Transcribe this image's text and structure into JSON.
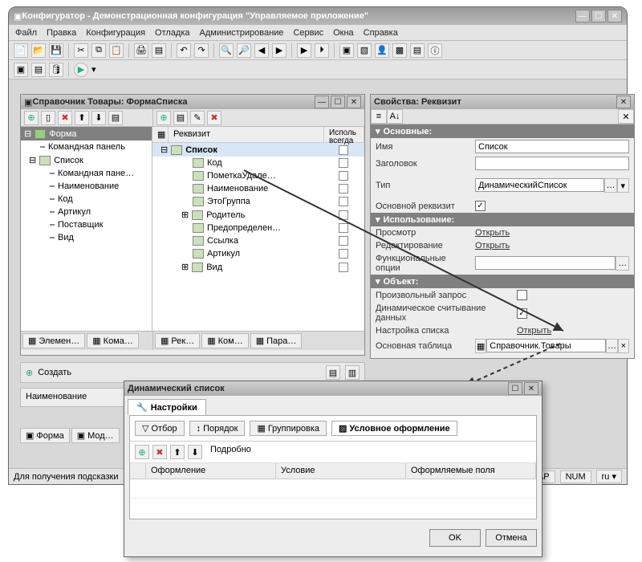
{
  "main_title": "Конфигуратор - Демонстрационная конфигурация \"Управляемое приложение\"",
  "menu": [
    "Файл",
    "Правка",
    "Конфигурация",
    "Отладка",
    "Администрирование",
    "Сервис",
    "Окна",
    "Справка"
  ],
  "form_win": {
    "title": "Справочник Товары: ФормаСписка",
    "left_tree": {
      "root": "Форма",
      "items": [
        "Командная панель",
        "Список"
      ],
      "sub": [
        "Командная пане…",
        "Наименование",
        "Код",
        "Артикул",
        "Поставщик",
        "Вид"
      ]
    },
    "right": {
      "col1": "Реквизит",
      "col2": "Исполь\nвсегда",
      "rows": [
        "Список",
        "Код",
        "ПометкаУдале…",
        "Наименование",
        "ЭтоГруппа",
        "Родитель",
        "Предопределен…",
        "Ссылка",
        "Артикул",
        "Вид"
      ]
    },
    "tabs_left": [
      "Элемен…",
      "Кома…"
    ],
    "tabs_right": [
      "Рек…",
      "Ком…",
      "Пара…"
    ]
  },
  "prop_win": {
    "title": "Свойства: Реквизит",
    "sections": {
      "s1": "Основные:",
      "s2": "Использование:",
      "s3": "Объект:"
    },
    "labels": {
      "name": "Имя",
      "caption": "Заголовок",
      "type": "Тип",
      "main": "Основной реквизит",
      "view": "Просмотр",
      "edit": "Редактирование",
      "func": "Функциональные опции",
      "arb": "Произвольный запрос",
      "dyn": "Динамическое считывание данных",
      "setup": "Настройка списка",
      "base": "Основная таблица"
    },
    "vals": {
      "name": "Список",
      "type": "ДинамическийСписок",
      "open": "Открыть",
      "base": "Справочник.Товары"
    }
  },
  "lower": {
    "create": "Создать",
    "col": "Наименование",
    "tabs": [
      "Форма",
      "Мод…"
    ]
  },
  "dlg": {
    "title": "Динамический список",
    "main_tab": "Настройки",
    "subtabs": [
      "Отбор",
      "Порядок",
      "Группировка",
      "Условное оформление"
    ],
    "detail": "Подробно",
    "cols": [
      "Оформление",
      "Условие",
      "Оформляемые поля"
    ],
    "ok": "OK",
    "cancel": "Отмена"
  },
  "status": {
    "hint": "Для получения подсказки",
    "cap": "CAP",
    "num": "NUM",
    "lang": "ru"
  }
}
